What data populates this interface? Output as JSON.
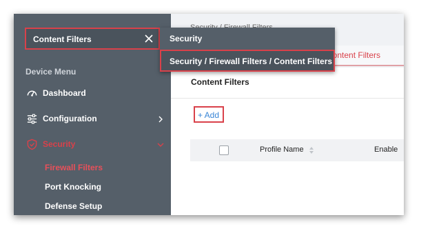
{
  "search": {
    "value": "Content Filters"
  },
  "sidebar": {
    "menu_title": "Device Menu",
    "items": [
      {
        "label": "Dashboard",
        "icon": "gauge-icon"
      },
      {
        "label": "Configuration",
        "icon": "sliders-icon"
      },
      {
        "label": "Security",
        "icon": "shield-icon"
      }
    ],
    "security_sub": [
      "Firewall Filters",
      "Port Knocking",
      "Defense Setup"
    ]
  },
  "main": {
    "breadcrumb": "Security / Firewall Filters",
    "active_tab": "Content Filters",
    "card_title": "Content Filters",
    "add_label": "+ Add",
    "columns": {
      "profile_name": "Profile Name",
      "enable": "Enable"
    }
  },
  "dropdown": {
    "title": "Security",
    "result": "Security / Firewall Filters / Content Filters"
  },
  "colors": {
    "sidebar_bg": "#555f69",
    "accent_red": "#d9414a",
    "link_blue": "#3a86d6"
  }
}
